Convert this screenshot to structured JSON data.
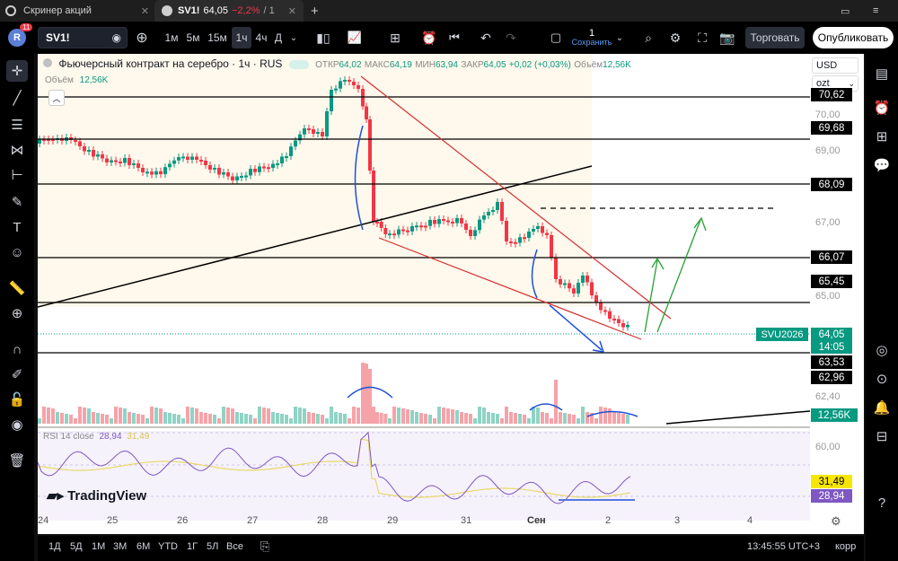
{
  "tabs": [
    {
      "label": "Скринер акций",
      "badge": ""
    },
    {
      "label": "SV1!",
      "price": "64,05",
      "change": "−2,2%",
      "count": "/ 1"
    }
  ],
  "toolbar": {
    "avatar_letter": "R",
    "avatar_badge": "11",
    "symbol": "SV1!",
    "intervals": [
      "1м",
      "5м",
      "15м",
      "1ч",
      "4ч",
      "Д"
    ],
    "active_interval": "1ч",
    "save_count": "1",
    "save_label": "Сохранить",
    "trade_label": "Торговать",
    "publish_label": "Опубликовать"
  },
  "legend": {
    "title": "Фьючерсный контракт на серебро · 1ч · RUS",
    "open_label": "ОТКР",
    "open": "64,02",
    "high_label": "МАКС",
    "high": "64,19",
    "low_label": "МИН",
    "low": "63,94",
    "close_label": "ЗАКР",
    "close": "64,05",
    "change": "+0,02 (+0,03%)",
    "volume_label": "Объём",
    "volume": "12,56K"
  },
  "volume_legend": {
    "label": "Объём",
    "value": "12,56K"
  },
  "rsi_legend": {
    "label": "RSI 14 close",
    "value": "28,94",
    "value2": "31,49"
  },
  "currency": {
    "label": "USD",
    "unit": "ozt"
  },
  "price_axis": {
    "ticks": [
      "70,00",
      "69,00",
      "67,00",
      "65,00",
      "62,40",
      "60,00"
    ],
    "levels": [
      {
        "label": "70,62",
        "color": "#000000"
      },
      {
        "label": "69,68",
        "color": "#000000"
      },
      {
        "label": "68,09",
        "color": "#000000"
      },
      {
        "label": "66,07",
        "color": "#000000"
      },
      {
        "label": "65,45",
        "color": "#000000"
      },
      {
        "label": "64,05",
        "color": "#089981"
      },
      {
        "label": "14:05",
        "color": "#089981"
      },
      {
        "label": "63,53",
        "color": "#000000"
      },
      {
        "label": "62,96",
        "color": "#000000"
      },
      {
        "label": "12,56K",
        "color": "#089981"
      },
      {
        "label": "31,49",
        "color": "#f7e600"
      },
      {
        "label": "28,94",
        "color": "#7e57c2"
      }
    ],
    "symbol_tag": "SVU2026"
  },
  "time_axis": [
    "24",
    "25",
    "26",
    "27",
    "28",
    "29",
    "31",
    "Сен",
    "2",
    "3",
    "4"
  ],
  "bottombar": {
    "ranges": [
      "1Д",
      "5Д",
      "1М",
      "3М",
      "6М",
      "YTD",
      "1Г",
      "5Л",
      "Все"
    ],
    "clock": "13:45:55 UTC+3",
    "mode": "корр"
  },
  "logo_text": "TradingView",
  "colors": {
    "up": "#089981",
    "down": "#f23645",
    "trend": "#d32f2f",
    "arrow_up": "#26a032",
    "arrow_blue": "#1e4fd8",
    "rsi": "#7e57c2",
    "rsi_ma": "#e8d96a"
  },
  "icons": [
    "crosshair-icon",
    "trend-line-icon",
    "fib-icon",
    "pattern-icon",
    "forecast-icon",
    "brush-icon",
    "text-icon",
    "emoji-icon",
    "ruler-icon",
    "zoom-icon",
    "magnet-icon",
    "lock-icon",
    "eye-icon",
    "trash-icon"
  ]
}
